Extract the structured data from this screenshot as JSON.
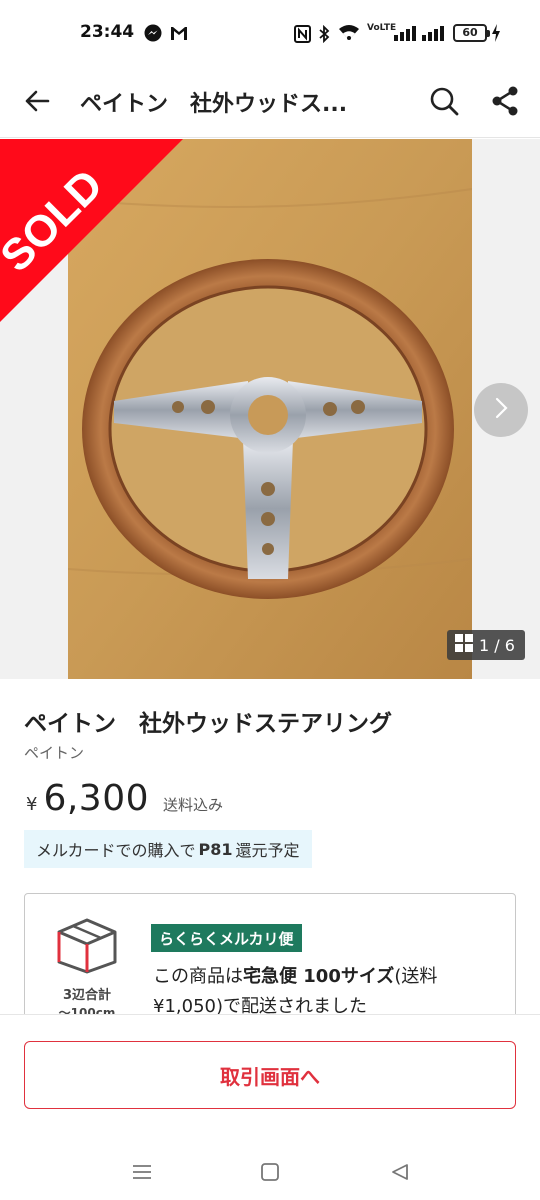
{
  "status_bar": {
    "time": "23:44",
    "network_label": "VoLTE",
    "battery": "60"
  },
  "app_bar": {
    "title": "ペイトン　社外ウッドス..."
  },
  "photo": {
    "sold_label": "SOLD",
    "counter": "1 / 6"
  },
  "item": {
    "name": "ペイトン　社外ウッドステアリング",
    "brand": "ペイトン",
    "currency": "¥",
    "price": "6,300",
    "shipping_included": "送料込み"
  },
  "points": {
    "before": "メルカードでの購入で",
    "points": "P81",
    "after": "還元予定"
  },
  "shipping": {
    "box_label": "3辺合計",
    "box_sub": "〜100cm",
    "badge": "らくらくメルカリ便",
    "text_1": "この商品は",
    "method_bold": "宅急便 100サイズ",
    "text_2": "(送料¥1,050)で配送されました"
  },
  "bottom": {
    "trade_button": "取引画面へ"
  },
  "colors": {
    "accent_red": "#e0313e",
    "sold_red": "#ff0a1a",
    "badge_green": "#1e7a5e",
    "points_bg": "#e7f6fc"
  },
  "icons": [
    "back-arrow-icon",
    "search-icon",
    "share-icon",
    "chevron-right-icon",
    "grid-icon",
    "box-icon",
    "menu-icon",
    "home-square-icon",
    "back-triangle-icon"
  ]
}
